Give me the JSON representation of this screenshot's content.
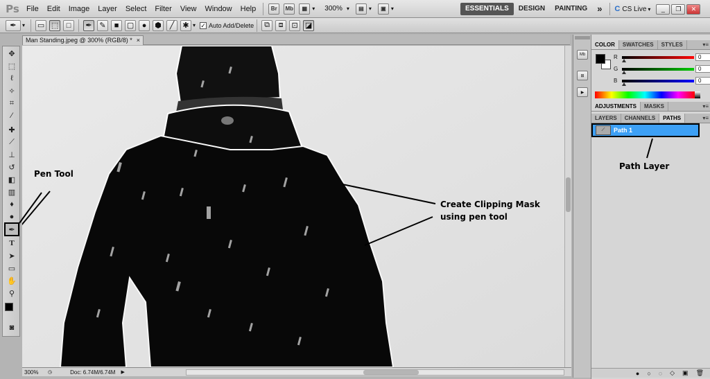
{
  "app": {
    "logo": "Ps"
  },
  "menu": [
    "File",
    "Edit",
    "Image",
    "Layer",
    "Select",
    "Filter",
    "View",
    "Window",
    "Help"
  ],
  "appbar": {
    "bridge_label": "Br",
    "minibridge_label": "Mb",
    "zoom": "300%"
  },
  "workspaces": {
    "essentials": "ESSENTIALS",
    "design": "DESIGN",
    "painting": "PAINTING",
    "more": "»"
  },
  "cslive": "CS Live",
  "options": {
    "auto_add_delete": "Auto Add/Delete"
  },
  "document": {
    "tab_title": "Man Standing.jpeg @ 300% (RGB/8) *",
    "tab_close": "×",
    "status_zoom": "300%",
    "doc_info": "Doc: 6.74M/6.74M"
  },
  "panels": {
    "color_tabs": [
      "COLOR",
      "SWATCHES",
      "STYLES"
    ],
    "channels": [
      {
        "label": "R",
        "value": "0",
        "color": "#e00000"
      },
      {
        "label": "G",
        "value": "0",
        "color": "#00b000"
      },
      {
        "label": "B",
        "value": "0",
        "color": "#0000d0"
      }
    ],
    "adjust_tabs": [
      "ADJUSTMENTS",
      "MASKS"
    ],
    "layer_tabs": [
      "LAYERS",
      "CHANNELS",
      "PATHS"
    ],
    "path_name": "Path 1",
    "menu_icon": "▾≡"
  },
  "annotations": {
    "pen_tool": "Pen Tool",
    "clip_line1": "Create Clipping Mask",
    "clip_line2": "using pen tool",
    "path_layer": "Path Layer"
  },
  "colors": {
    "path_selected": "#3da0f5",
    "workspace_active": "#555555"
  }
}
